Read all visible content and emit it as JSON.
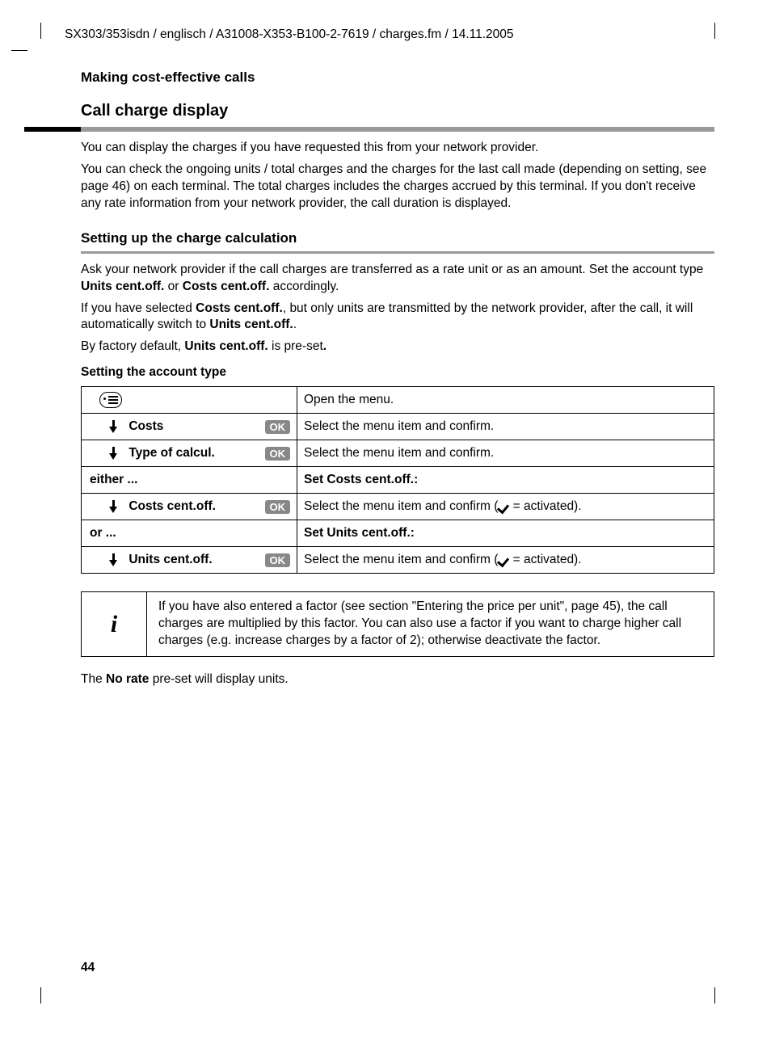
{
  "header_path": "SX303/353isdn / englisch / A31008-X353-B100-2-7619 / charges.fm / 14.11.2005",
  "section_label": "Making cost-effective calls",
  "h2": "Call charge display",
  "intro1": "You can display the charges if you have requested this from your network provider.",
  "intro2": "You can check the ongoing units / total charges and the charges for the last call made (depending on setting, see page 46) on each terminal. The total charges includes the charges accrued by this terminal. If you don't receive any rate information from your network provider, the call duration is displayed.",
  "h3": "Setting up the charge calculation",
  "setup1_pre": "Ask your network provider if the call charges are transferred as a rate unit or as an amount. Set the account type ",
  "setup1_b1": "Units cent.off.",
  "setup1_mid": " or ",
  "setup1_b2": "Costs cent.off.",
  "setup1_post": " accordingly.",
  "setup2_pre": "If you have selected ",
  "setup2_b1": "Costs cent.off.",
  "setup2_mid": ", but only units are transmitted by the network provider, after the call, it will automatically switch to ",
  "setup2_b2": "Units cent.off.",
  "setup2_post": ".",
  "setup3_pre": "By factory default, ",
  "setup3_b": "Units cent.off.",
  "setup3_post": " is pre-set",
  "setup3_dot": ".",
  "h4": "Setting the account type",
  "table": {
    "row1_desc": "Open the menu.",
    "row2_label": "Costs",
    "row2_ok": "OK",
    "row2_desc": "Select the menu item and confirm.",
    "row3_label": "Type of calcul.",
    "row3_ok": "OK",
    "row3_desc": "Select the menu item and confirm.",
    "either_label": "either ...",
    "either_head": "Set Costs cent.off.:",
    "row4_label": "Costs cent.off.",
    "row4_ok": "OK",
    "row4_desc_pre": "Select the menu item and confirm (",
    "row4_desc_post": " = activated).",
    "or_label": "or ...",
    "or_head": "Set Units cent.off.:",
    "row5_label": "Units cent.off.",
    "row5_ok": "OK",
    "row5_desc_pre": "Select the menu item and confirm (",
    "row5_desc_post": " = activated)."
  },
  "info_icon": "i",
  "info_text": "If you have also entered a factor (see section \"Entering the price per unit\", page 45), the call charges are multiplied by this factor. You can also use a factor if you want to charge higher call charges (e.g. increase charges by a factor of 2); otherwise deactivate the factor.",
  "final_pre": "The ",
  "final_b": "No rate",
  "final_post": " pre-set will display units.",
  "page_number": "44"
}
